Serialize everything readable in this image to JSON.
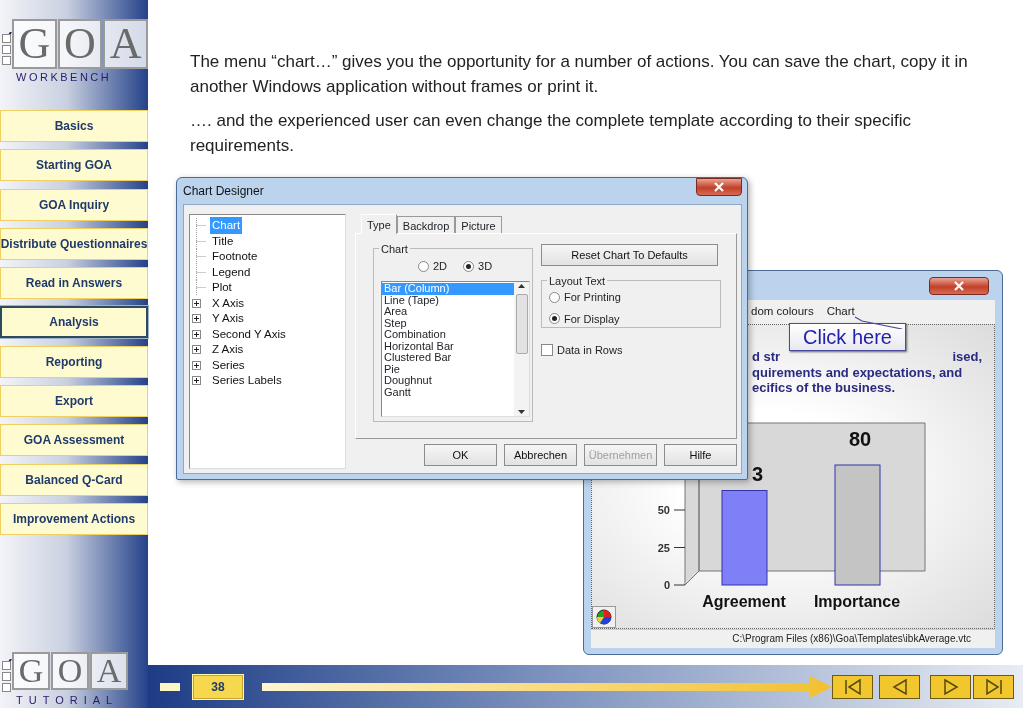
{
  "sidebar": {
    "logo": {
      "letters": [
        "G",
        "O",
        "A"
      ],
      "subtitle": "WORKBENCH"
    },
    "nav": [
      {
        "label": "Basics",
        "selected": false
      },
      {
        "label": "Starting GOA",
        "selected": false
      },
      {
        "label": "GOA Inquiry",
        "selected": false
      },
      {
        "label": "Distribute Questionnaires",
        "selected": false
      },
      {
        "label": "Read in Answers",
        "selected": false
      },
      {
        "label": "Analysis",
        "selected": true
      },
      {
        "label": "Reporting",
        "selected": false
      },
      {
        "label": "Export",
        "selected": false
      },
      {
        "label": "GOA Assessment",
        "selected": false
      },
      {
        "label": "Balanced Q-Card",
        "selected": false
      },
      {
        "label": "Improvement Actions",
        "selected": false
      }
    ],
    "bottom_logo": {
      "letters": [
        "G",
        "O",
        "A"
      ],
      "subtitle": "TUTORIAL"
    }
  },
  "intro": [
    "The menu “chart…” gives you the opportunity for a number of actions. You can save the chart, copy it in another Windows application without frames or print it.",
    "…. and the experienced user can even change the complete template according to their specific requirements."
  ],
  "chart_window": {
    "menu": [
      "dom colours",
      "Chart"
    ],
    "text_lines": [
      [
        "d str",
        "ised,"
      ],
      [
        "quirements and expectations, and"
      ],
      [
        "ecifics of the business."
      ]
    ],
    "callout": "Click here",
    "chart_data": {
      "type": "bar",
      "categories": [
        "Agreement",
        "Importance"
      ],
      "values": [
        63,
        80
      ],
      "ylim": [
        0,
        108
      ],
      "yticks": [
        0,
        25,
        50
      ]
    },
    "bar_labels": [
      "3",
      "80"
    ],
    "status": "C:\\Program Files (x86)\\Goa\\Templates\\ibkAverage.vtc"
  },
  "dialog": {
    "title": "Chart Designer",
    "tree": [
      {
        "label": "Chart",
        "expandable": false,
        "selected": true
      },
      {
        "label": "Title",
        "expandable": false,
        "selected": false
      },
      {
        "label": "Footnote",
        "expandable": false,
        "selected": false
      },
      {
        "label": "Legend",
        "expandable": false,
        "selected": false
      },
      {
        "label": "Plot",
        "expandable": false,
        "selected": false
      },
      {
        "label": "X Axis",
        "expandable": true,
        "selected": false
      },
      {
        "label": "Y Axis",
        "expandable": true,
        "selected": false
      },
      {
        "label": "Second Y Axis",
        "expandable": true,
        "selected": false
      },
      {
        "label": "Z Axis",
        "expandable": true,
        "selected": false
      },
      {
        "label": "Series",
        "expandable": true,
        "selected": false
      },
      {
        "label": "Series Labels",
        "expandable": true,
        "selected": false
      }
    ],
    "tabs": [
      {
        "label": "Type",
        "selected": true
      },
      {
        "label": "Backdrop",
        "selected": false
      },
      {
        "label": "Picture",
        "selected": false
      }
    ],
    "chart_group": {
      "title": "Chart",
      "modes": [
        {
          "label": "2D",
          "selected": false
        },
        {
          "label": "3D",
          "selected": true
        }
      ],
      "types": [
        {
          "label": "Bar (Column)",
          "selected": true
        },
        {
          "label": "Line (Tape)",
          "selected": false
        },
        {
          "label": "Area",
          "selected": false
        },
        {
          "label": "Step",
          "selected": false
        },
        {
          "label": "Combination",
          "selected": false
        },
        {
          "label": "Horizontal Bar",
          "selected": false
        },
        {
          "label": "Clustered Bar",
          "selected": false
        },
        {
          "label": "Pie",
          "selected": false
        },
        {
          "label": "Doughnut",
          "selected": false
        },
        {
          "label": "Gantt",
          "selected": false
        }
      ]
    },
    "reset_button": "Reset Chart To Defaults",
    "layout_group": {
      "title": "Layout Text",
      "options": [
        {
          "label": "For Printing",
          "selected": false
        },
        {
          "label": "For Display",
          "selected": true
        }
      ]
    },
    "data_in_rows": {
      "label": "Data in Rows",
      "checked": false
    },
    "buttons": [
      {
        "label": "OK",
        "disabled": false
      },
      {
        "label": "Abbrechen",
        "disabled": false
      },
      {
        "label": "Übernehmen",
        "disabled": true
      },
      {
        "label": "Hilfe",
        "disabled": false
      }
    ]
  },
  "footer": {
    "page": "38"
  }
}
